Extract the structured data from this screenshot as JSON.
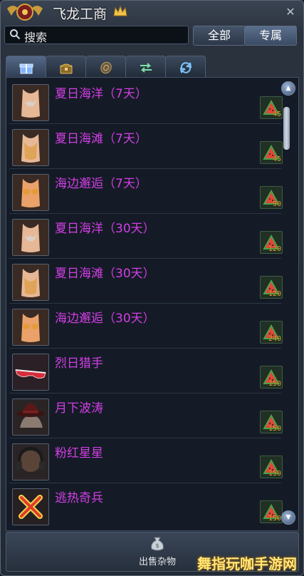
{
  "title": "飞龙工商",
  "search": {
    "label": "搜索"
  },
  "filters": {
    "all": "全部",
    "exclusive": "专属"
  },
  "tabs": [
    {
      "icon": "gift-icon",
      "active": true
    },
    {
      "icon": "chest-icon",
      "active": false
    },
    {
      "icon": "coin-icon",
      "active": false
    },
    {
      "icon": "swap-arrows-icon",
      "active": false
    },
    {
      "icon": "refresh-icon",
      "active": false
    }
  ],
  "items": [
    {
      "name": "夏日海洋（7天）",
      "price": "45",
      "color": "#d9d0c8"
    },
    {
      "name": "夏日海滩（7天）",
      "price": "45",
      "color": "#e0a458"
    },
    {
      "name": "海边邂逅（7天）",
      "price": "90",
      "color": "#e79a3a"
    },
    {
      "name": "夏日海洋（30天）",
      "price": "120",
      "color": "#d9d0c8"
    },
    {
      "name": "夏日海滩（30天）",
      "price": "120",
      "color": "#e0a458"
    },
    {
      "name": "海边邂逅（30天）",
      "price": "240",
      "color": "#e79a3a"
    },
    {
      "name": "烈日猎手",
      "price": "150",
      "color": "#d62c3a"
    },
    {
      "name": "月下波涛",
      "price": "150",
      "color": "#7a2020"
    },
    {
      "name": "粉红星星",
      "price": "150",
      "color": "#5a4438"
    },
    {
      "name": "逃热奇兵",
      "price": "150",
      "color": "#e23a2a"
    }
  ],
  "bottom": {
    "sell_label": "出售杂物"
  },
  "watermark": "舞指玩咖手游网",
  "colors": {
    "item_name": "#d33ee6",
    "price": "#e5b23a"
  }
}
